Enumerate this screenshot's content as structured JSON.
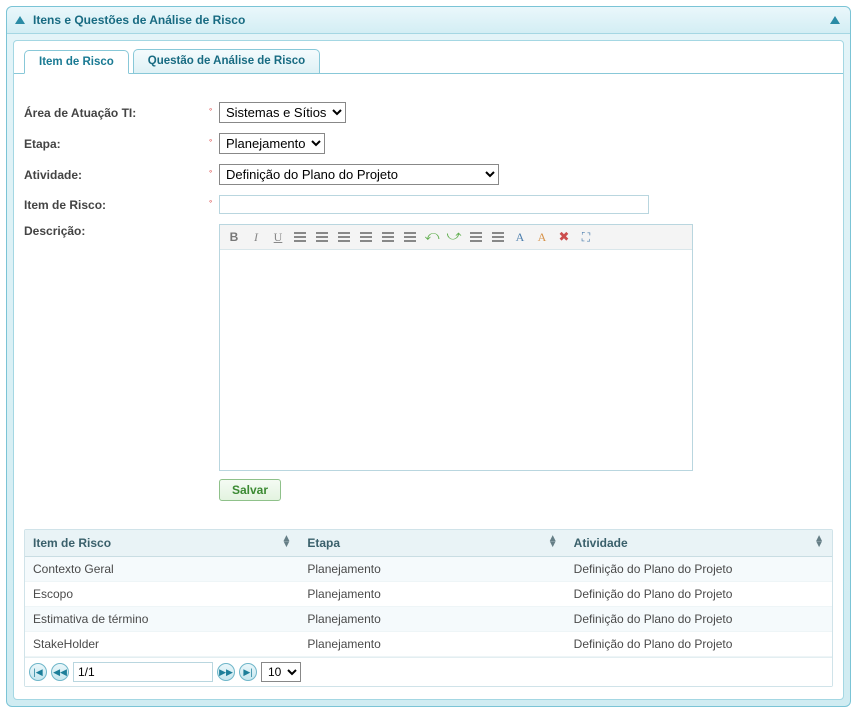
{
  "panel": {
    "title": "Itens e Questões de Análise de Risco"
  },
  "tabs": [
    {
      "label": "Item de Risco",
      "active": true
    },
    {
      "label": "Questão de Análise de Risco",
      "active": false
    }
  ],
  "form": {
    "area_label": "Área de Atuação TI:",
    "area_value": "Sistemas e Sítios",
    "etapa_label": "Etapa:",
    "etapa_value": "Planejamento",
    "atividade_label": "Atividade:",
    "atividade_value": "Definição do Plano do Projeto",
    "item_label": "Item de Risco:",
    "item_value": "",
    "descricao_label": "Descrição:",
    "save_label": "Salvar"
  },
  "table": {
    "columns": [
      "Item de Risco",
      "Etapa",
      "Atividade"
    ],
    "rows": [
      {
        "item": "Contexto Geral",
        "etapa": "Planejamento",
        "atividade": "Definição do Plano do Projeto"
      },
      {
        "item": "Escopo",
        "etapa": "Planejamento",
        "atividade": "Definição do Plano do Projeto"
      },
      {
        "item": "Estimativa de término",
        "etapa": "Planejamento",
        "atividade": "Definição do Plano do Projeto"
      },
      {
        "item": "StakeHolder",
        "etapa": "Planejamento",
        "atividade": "Definição do Plano do Projeto"
      }
    ]
  },
  "pager": {
    "page_text": "1/1",
    "page_size": "10"
  }
}
